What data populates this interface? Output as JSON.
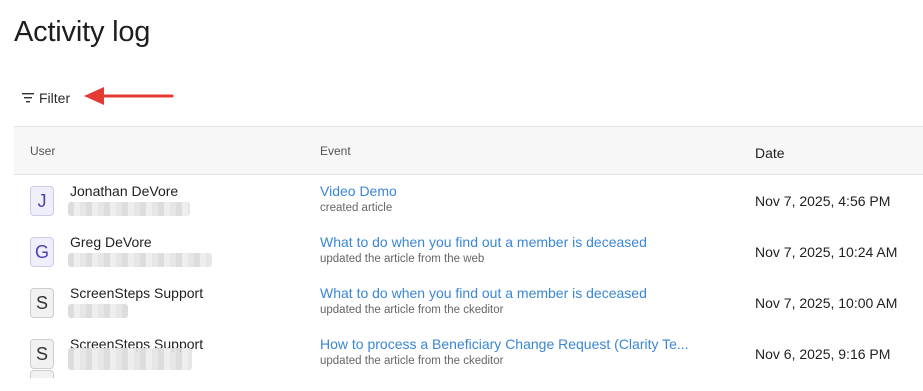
{
  "page": {
    "title": "Activity log"
  },
  "filter": {
    "label": "Filter"
  },
  "annotation": {
    "color": "#e53935"
  },
  "table": {
    "headers": {
      "user": "User",
      "event": "Event",
      "date": "Date"
    },
    "rows": [
      {
        "initial": "J",
        "avatar_style": "purple",
        "user": "Jonathan DeVore",
        "event": "Video Demo",
        "event_sub": "created article",
        "date": "Nov 7, 2025, 4:56 PM"
      },
      {
        "initial": "G",
        "avatar_style": "purple",
        "user": "Greg DeVore",
        "event": "What to do when you find out a member is deceased",
        "event_sub": "updated the article from the web",
        "date": "Nov 7, 2025, 10:24 AM"
      },
      {
        "initial": "S",
        "avatar_style": "gray",
        "user": "ScreenSteps Support",
        "event": "What to do when you find out a member is deceased",
        "event_sub": "updated the article from the ckeditor",
        "date": "Nov 7, 2025, 10:00 AM"
      },
      {
        "initial": "S",
        "avatar_style": "gray",
        "user": "ScreenSteps Support",
        "event": "How to process a Beneficiary Change Request (Clarity Te...",
        "event_sub": "updated the article from the ckeditor",
        "date": "Nov 6, 2025, 9:16 PM"
      }
    ]
  }
}
